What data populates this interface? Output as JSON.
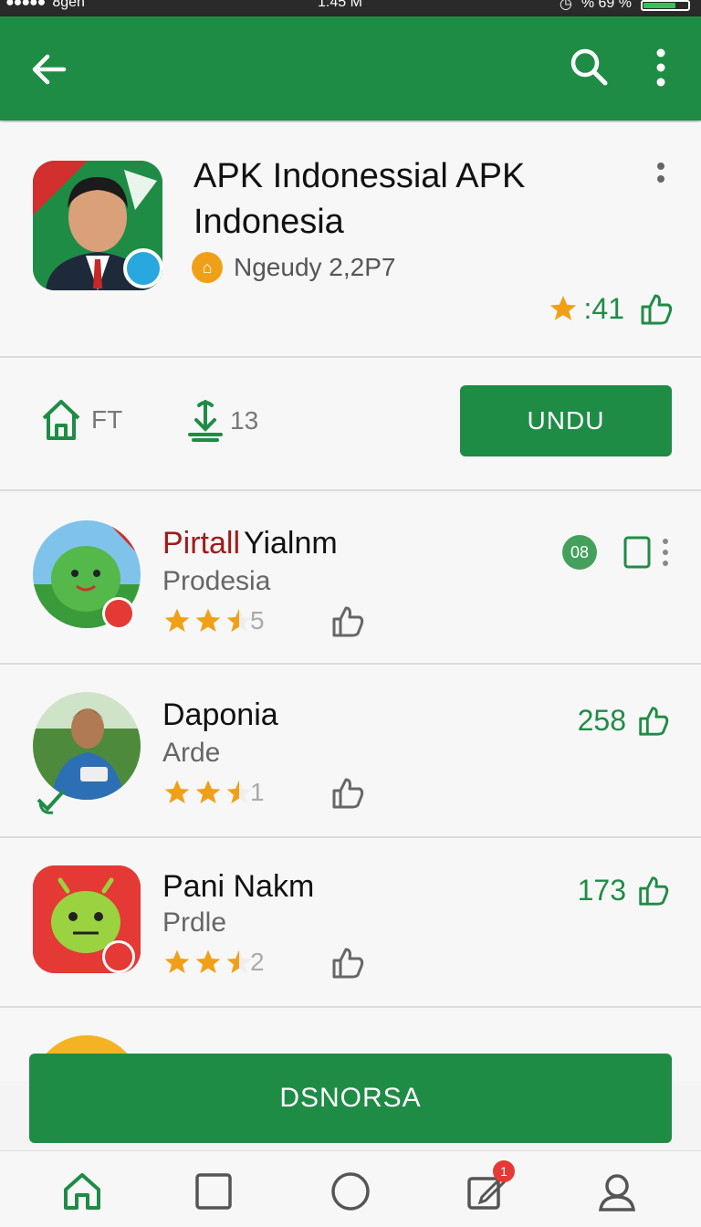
{
  "status_bar": {
    "carrier": "8gen",
    "time": "1:45 M",
    "battery_text": "% 69 %",
    "battery_level": 0.69
  },
  "app_bar": {
    "back_icon": "arrow-left-icon",
    "search_icon": "search-icon",
    "more_icon": "more-vert-icon"
  },
  "header": {
    "title": "APK Indonessial APK Indonesia",
    "developer": "Ngeudy 2,2P7",
    "rating_value": ":41",
    "colors": {
      "accent": "#1f8c46",
      "star": "#f0a018"
    }
  },
  "stats": {
    "stat1_label": "FT",
    "stat2_label": "13",
    "install_label": "UNDU"
  },
  "items": [
    {
      "name": "Pirtall",
      "name_suffix": "Yialnm",
      "sub": "Prodesia",
      "rating_suffix": "5",
      "right_badge": "08"
    },
    {
      "name": "Daponia",
      "sub": "Arde",
      "rating_suffix": "1",
      "right_count": "258"
    },
    {
      "name": "Pani Nakm",
      "sub": "Prdle",
      "rating_suffix": "2",
      "right_count": "173"
    }
  ],
  "cta": {
    "label": "DSNORSA"
  },
  "bottom_nav": {
    "notification_count": "1"
  }
}
